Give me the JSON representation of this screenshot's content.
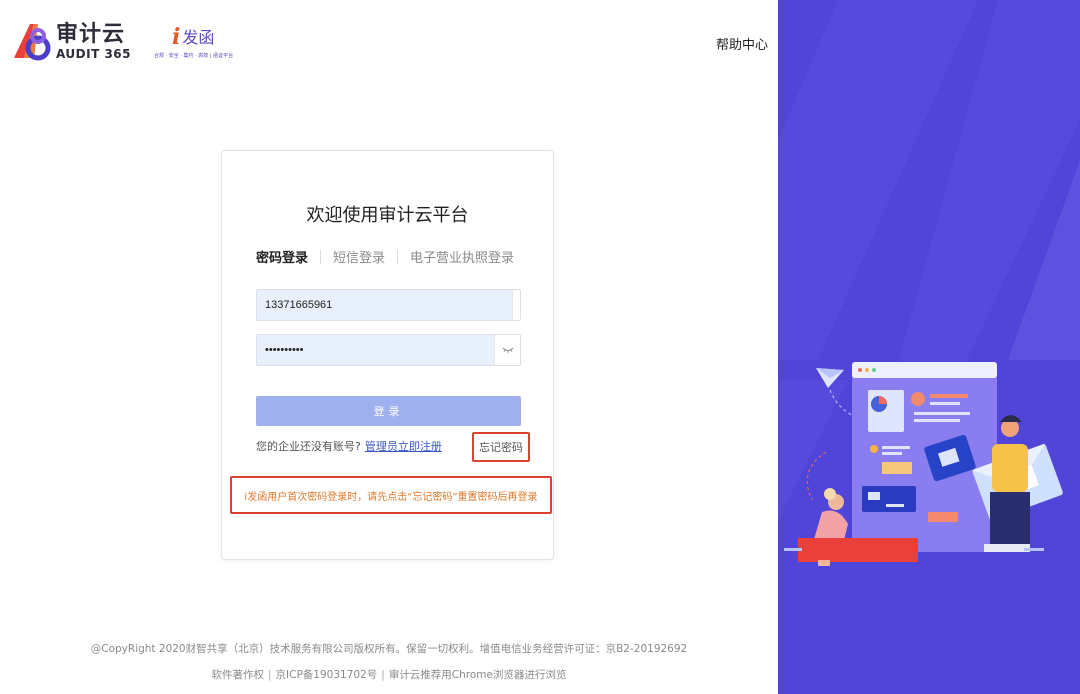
{
  "header": {
    "logo_cn": "审计云",
    "logo_en": "AUDIT 365",
    "partner_logo_i": "i",
    "partner_logo_cn": "发函",
    "partner_slogan": "合规 · 安全 · 集约 · 高效 | 函证平台",
    "help_link": "帮助中心"
  },
  "login": {
    "title": "欢迎使用审计云平台",
    "tabs": [
      {
        "label": "密码登录",
        "active": true
      },
      {
        "label": "短信登录",
        "active": false
      },
      {
        "label": "电子营业执照登录",
        "active": false
      }
    ],
    "phone_value": "13371665961",
    "password_value": "••••••••••",
    "login_button": "登录",
    "register_prompt": "您的企业还没有账号?",
    "register_link": "管理员立即注册",
    "forgot_link": "忘记密码",
    "notice": "i发函用户首次密码登录时，请先点击“忘记密码”重置密码后再登录"
  },
  "footer": {
    "line1": "@CopyRight 2020财智共享（北京）技术服务有限公司版权所有。保留一切权利。增值电信业务经营许可证：京B2-20192692",
    "line2_items": [
      "软件著作权",
      "京ICP备19031702号",
      "审计云推荐用Chrome浏览器进行浏览"
    ],
    "separator": "|"
  },
  "colors": {
    "side_panel": "#5145d9",
    "login_button": "#9fb0ee",
    "highlight_border": "#d9432f",
    "notice_text": "#e0782a",
    "link": "#3a57c7"
  }
}
